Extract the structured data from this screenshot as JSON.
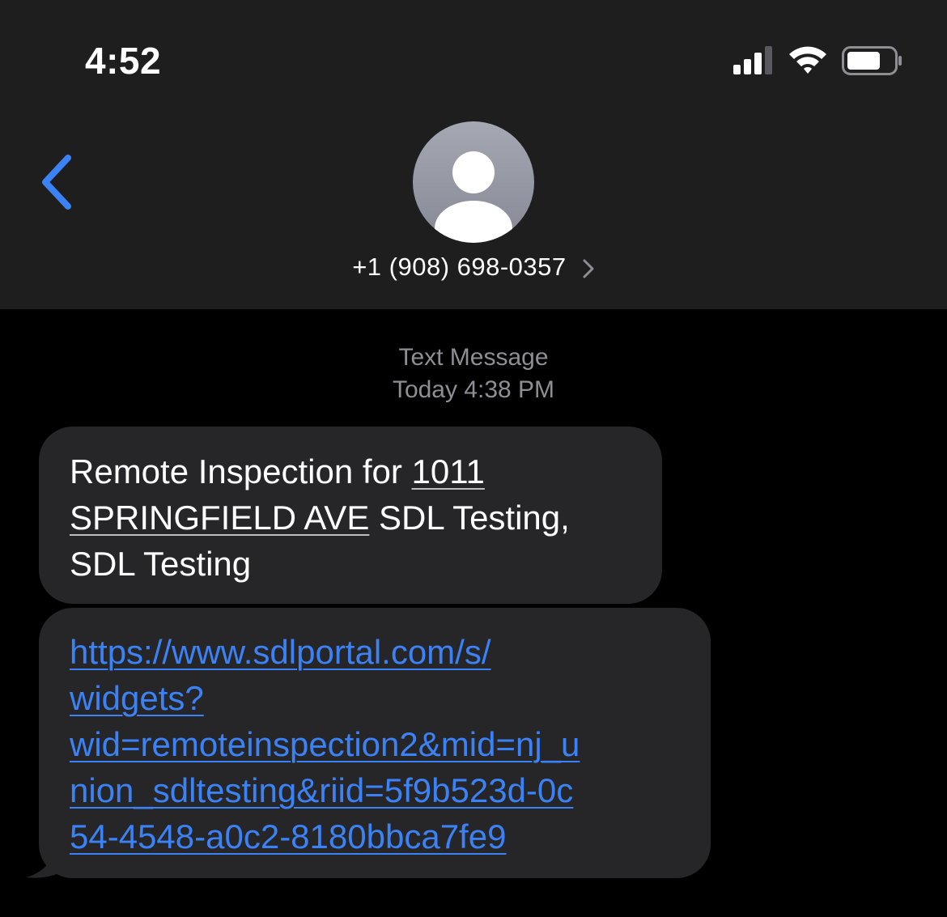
{
  "status_bar": {
    "time": "4:52",
    "icons": [
      "cellular-signal-icon",
      "wifi-icon",
      "battery-icon"
    ]
  },
  "nav": {
    "back_icon": "chevron-left-icon",
    "avatar_icon": "person-silhouette-icon",
    "contact_label": "+1 (908) 698-0357",
    "contact_chevron": "chevron-right-icon"
  },
  "conversation": {
    "service_label": "Text Message",
    "timestamp": "Today 4:38 PM",
    "messages": [
      {
        "text_before": "Remote Inspection for ",
        "address_line1": "1011",
        "address_line2": "SPRINGFIELD AVE",
        "text_after_line2": " SDL Testing,",
        "line3": "SDL Testing"
      },
      {
        "link_lines": [
          "https://www.sdlportal.com/s/",
          "widgets?",
          "wid=remoteinspection2&mid=nj_u",
          "nion_sdltesting&riid=5f9b523d-0c",
          "54-4548-a0c2-8180bbca7fe9"
        ]
      }
    ]
  },
  "colors": {
    "header_bg": "#1e1e1e",
    "page_bg": "#000000",
    "bubble_bg": "#262628",
    "accent_blue": "#3b82f6",
    "meta_gray": "#8e8e93"
  }
}
